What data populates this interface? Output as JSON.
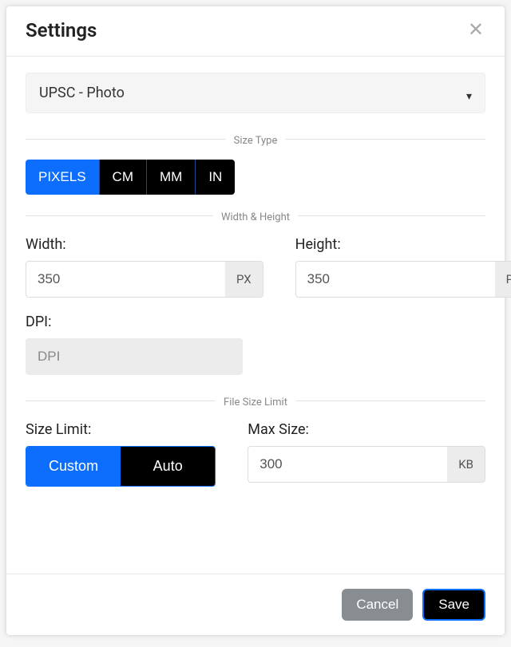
{
  "modal": {
    "title": "Settings",
    "close_aria": "Close"
  },
  "preset": {
    "selected": "UPSC - Photo"
  },
  "size_type": {
    "legend": "Size Type",
    "options": [
      "PIXELS",
      "CM",
      "MM",
      "IN"
    ],
    "selected": "PIXELS"
  },
  "dimensions": {
    "legend": "Width & Height",
    "width": {
      "label": "Width:",
      "value": "350",
      "unit": "PX"
    },
    "height": {
      "label": "Height:",
      "value": "350",
      "unit": "PX"
    },
    "dpi": {
      "label": "DPI:",
      "placeholder": "DPI"
    }
  },
  "file_size": {
    "legend": "File Size Limit",
    "limit_label": "Size Limit:",
    "max_label": "Max Size:",
    "options": {
      "custom": "Custom",
      "auto": "Auto"
    },
    "selected": "Custom",
    "max_value": "300",
    "max_unit": "KB"
  },
  "footer": {
    "cancel": "Cancel",
    "save": "Save"
  }
}
